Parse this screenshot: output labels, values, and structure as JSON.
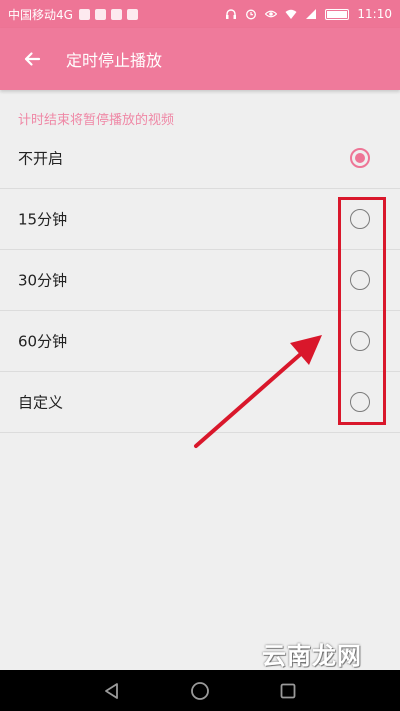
{
  "status_bar": {
    "carrier": "中国移动4G",
    "time": "11:10",
    "icons": [
      "notification-icon",
      "notification-icon",
      "notification-icon",
      "notification-icon",
      "headphones-icon",
      "alarm-icon",
      "eye-icon",
      "wifi-icon",
      "signal-icon",
      "battery-icon"
    ]
  },
  "app_bar": {
    "title": "定时停止播放",
    "back_icon": "arrow-left-icon"
  },
  "section_header": "计时结束将暂停播放的视频",
  "options": [
    {
      "label": "不开启",
      "selected": true
    },
    {
      "label": "15分钟",
      "selected": false
    },
    {
      "label": "30分钟",
      "selected": false
    },
    {
      "label": "60分钟",
      "selected": false
    },
    {
      "label": "自定义",
      "selected": false
    }
  ],
  "watermark": "云南龙网",
  "colors": {
    "accent": "#ee7596",
    "highlight": "#d9172b",
    "section_header": "#ef88a6"
  },
  "nav_bar": {
    "icons": [
      "back-triangle-icon",
      "home-circle-icon",
      "recents-square-icon"
    ]
  }
}
